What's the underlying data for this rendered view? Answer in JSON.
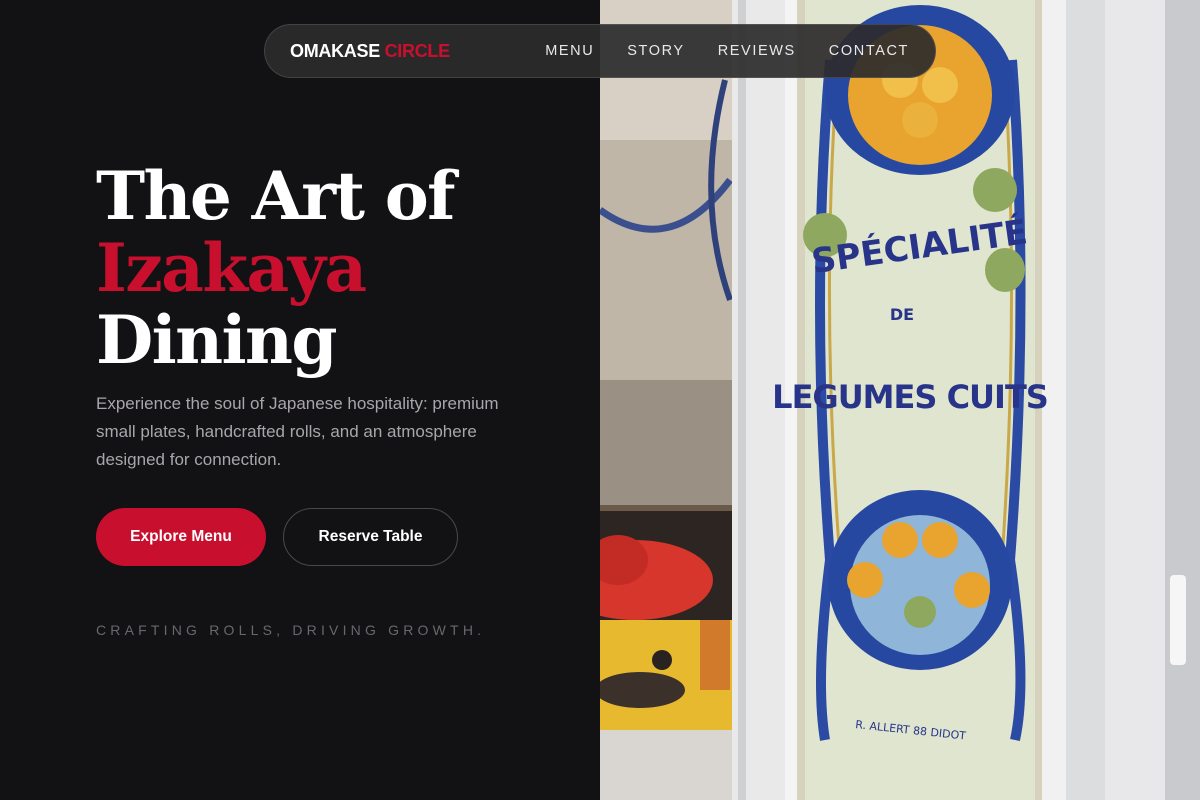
{
  "brand": {
    "first": "OMAKASE",
    "second": "CIRCLE"
  },
  "nav": {
    "items": [
      "MENU",
      "STORY",
      "REVIEWS",
      "CONTACT"
    ]
  },
  "hero": {
    "title_line1": "The Art of",
    "title_accent": "Izakaya",
    "title_line3": "Dining",
    "lead": "Experience the soul of Japanese hospitality: premium small plates, handcrafted rolls, and an atmosphere designed for connection.",
    "primary_cta": "Explore Menu",
    "secondary_cta": "Reserve Table",
    "tagline": "CRAFTING ROLLS, DRIVING GROWTH."
  },
  "photo": {
    "sign_top": "SPÉCIALITÉ",
    "sign_middle": "DE",
    "sign_bottom": "LEGUMES CUITS",
    "sign_credit": "R. ALLERT 88 DIDOT"
  },
  "colors": {
    "accent": "#c8102e",
    "background": "#121113",
    "nav_bg": "#2c2b2d"
  }
}
